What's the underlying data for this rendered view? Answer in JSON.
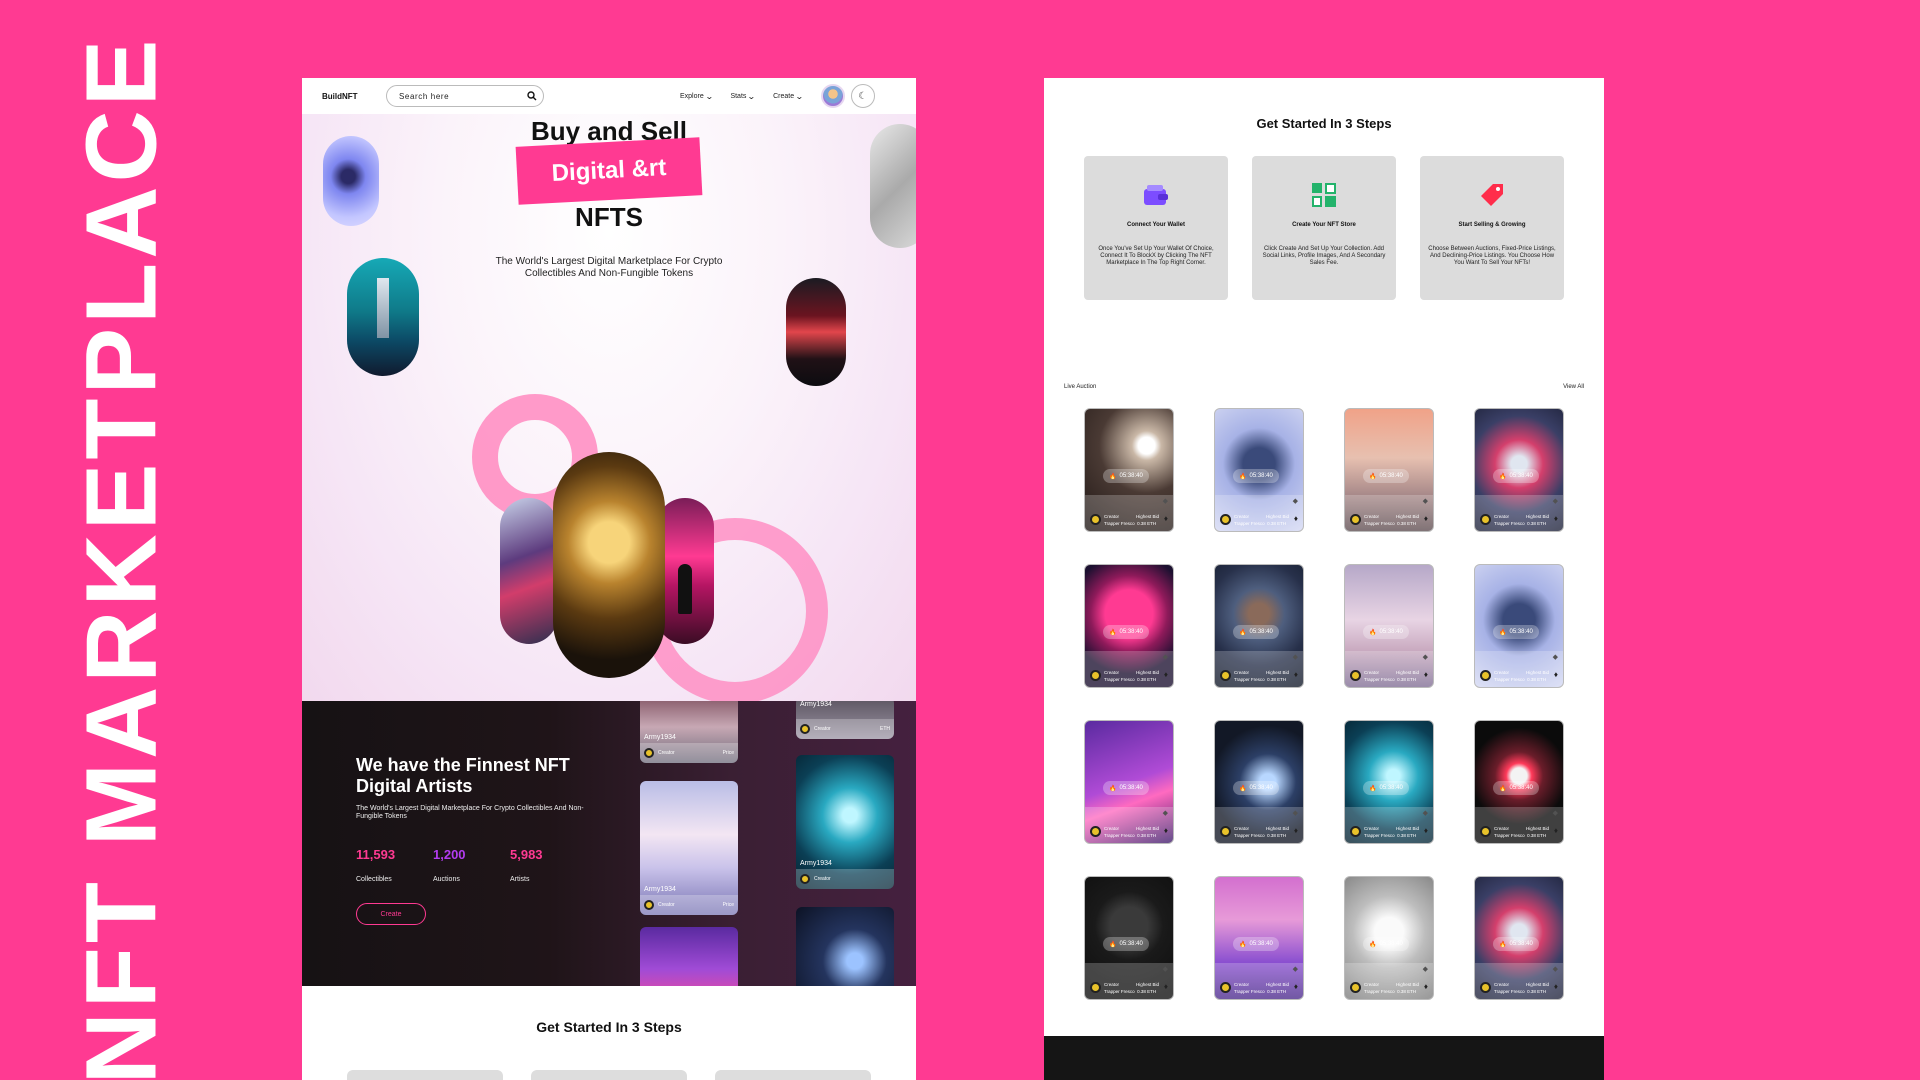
{
  "banner": {
    "title": "NFT MARKETPLACE"
  },
  "colors": {
    "background": "#ff3a92",
    "accent_pink": "#ff3a92",
    "accent_purple": "#b23cf0"
  },
  "nav": {
    "brand": "BuildNFT",
    "search_placeholder": "Search here",
    "links": [
      "Explore",
      "Stats",
      "Create"
    ]
  },
  "hero": {
    "line1": "Buy and Sell",
    "line2": "Digital &rt",
    "line3": "NFTS",
    "subtitle": "The World's Largest Digital Marketplace For Crypto Collectibles And Non-Fungible Tokens"
  },
  "artists": {
    "title": "We have the Finnest NFT Digital Artists",
    "subtitle": "The World's Largest Digital Marketplace For Crypto Collectibles And Non-Fungible Tokens",
    "stats": [
      {
        "value": "11,593",
        "label": "Collectibles",
        "color": "#ff3a92"
      },
      {
        "value": "1,200",
        "label": "Auctions",
        "color": "#b23cf0"
      },
      {
        "value": "5,983",
        "label": "Artists",
        "color": "#ff3a92"
      }
    ],
    "create_label": "Create",
    "card_user": "Army1934",
    "card_creator": "Creator",
    "card_price": "Price",
    "card_price_unit": "ETH"
  },
  "get_started": {
    "title": "Get Started In 3 Steps",
    "steps": [
      {
        "icon": "wallet-icon",
        "title": "Connect Your Wallet",
        "desc": "Once You've Set Up Your Wallet Of Choice, Connect It To BlockX by Clicking The NFT Marketplace In The Top Right Corner."
      },
      {
        "icon": "store-icon",
        "title": "Create Your NFT Store",
        "desc": "Click Create And Set Up Your Collection. Add Social Links, Profile Images, And A Secondary Sales Fee."
      },
      {
        "icon": "tag-icon",
        "title": "Start Selling & Growing",
        "desc": "Choose Between Auctions, Fixed-Price Listings, And Declining-Price Listings. You Choose How You Want To Sell Your NFTs!"
      }
    ]
  },
  "live_auction": {
    "label": "Live Auction",
    "view_all": "View All",
    "timer": "05:38:40",
    "creator": "Creator",
    "creator_name": "Trapper Fresco",
    "highest_bid_label": "Highest Bid",
    "highest_bid_value": "0.38 ETH"
  }
}
